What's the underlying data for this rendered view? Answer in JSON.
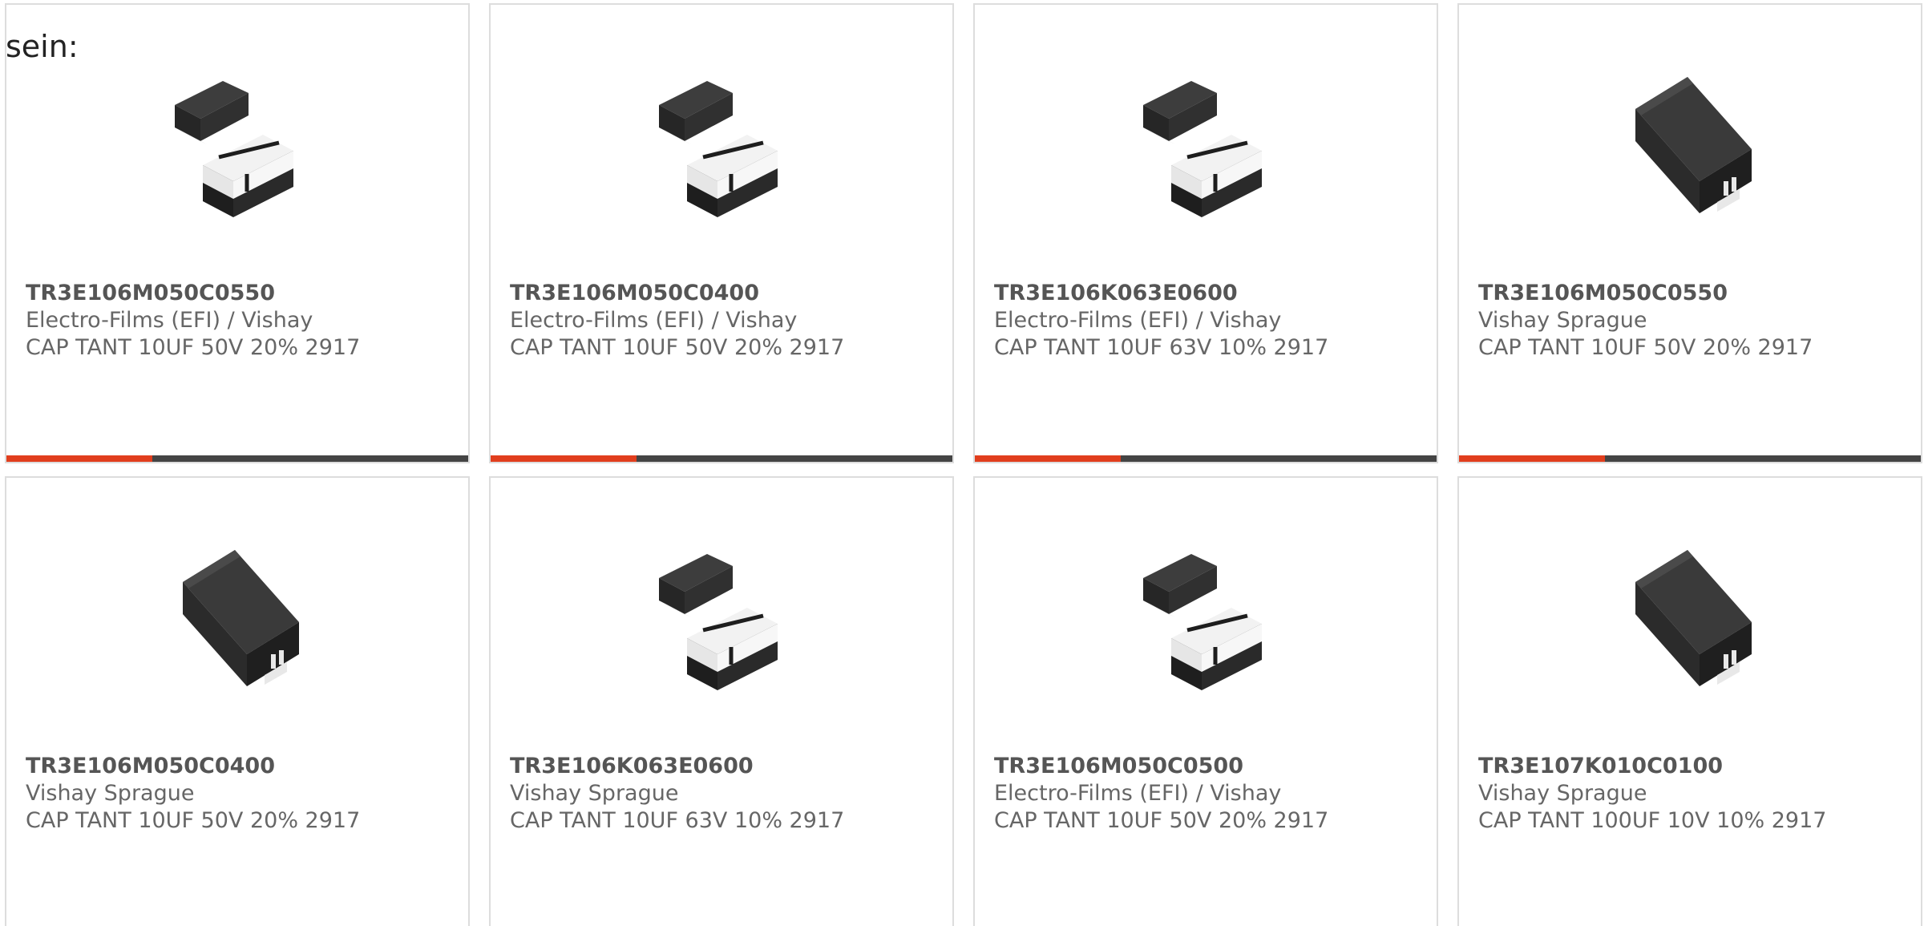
{
  "intro_text": "sein:",
  "colors": {
    "accent": "#e13e1d",
    "bar": "#444444",
    "border": "#dddddd"
  },
  "products": [
    {
      "part_no": "TR3E106M050C0550",
      "manufacturer": "Electro-Films (EFI) / Vishay",
      "description": "CAP TANT 10UF 50V 20% 2917",
      "image": "smd-tantalum-pair",
      "show_bar": true
    },
    {
      "part_no": "TR3E106M050C0400",
      "manufacturer": "Electro-Films (EFI) / Vishay",
      "description": "CAP TANT 10UF 50V 20% 2917",
      "image": "smd-tantalum-pair",
      "show_bar": true
    },
    {
      "part_no": "TR3E106K063E0600",
      "manufacturer": "Electro-Films (EFI) / Vishay",
      "description": "CAP TANT 10UF 63V 10% 2917",
      "image": "smd-tantalum-pair",
      "show_bar": true
    },
    {
      "part_no": "TR3E106M050C0550",
      "manufacturer": "Vishay Sprague",
      "description": "CAP TANT 10UF 50V 20% 2917",
      "image": "smd-tantalum-block",
      "show_bar": true
    },
    {
      "part_no": "TR3E106M050C0400",
      "manufacturer": "Vishay Sprague",
      "description": "CAP TANT 10UF 50V 20% 2917",
      "image": "smd-tantalum-block",
      "show_bar": false
    },
    {
      "part_no": "TR3E106K063E0600",
      "manufacturer": "Vishay Sprague",
      "description": "CAP TANT 10UF 63V 10% 2917",
      "image": "smd-tantalum-pair",
      "show_bar": false
    },
    {
      "part_no": "TR3E106M050C0500",
      "manufacturer": "Electro-Films (EFI) / Vishay",
      "description": "CAP TANT 10UF 50V 20% 2917",
      "image": "smd-tantalum-pair",
      "show_bar": false
    },
    {
      "part_no": "TR3E107K010C0100",
      "manufacturer": "Vishay Sprague",
      "description": "CAP TANT 100UF 10V 10% 2917",
      "image": "smd-tantalum-block",
      "show_bar": false
    }
  ]
}
